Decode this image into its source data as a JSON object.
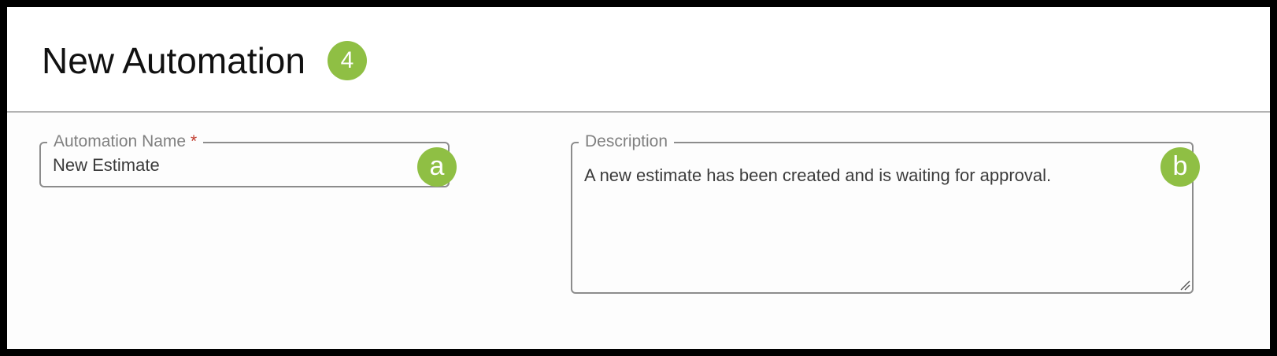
{
  "header": {
    "title": "New Automation",
    "badge": "4"
  },
  "form": {
    "name_field": {
      "label": "Automation Name",
      "required_mark": "*",
      "value": "New Estimate",
      "badge": "a"
    },
    "description_field": {
      "label": "Description",
      "value": "A new estimate has been created and is waiting for approval.",
      "badge": "b",
      "resize_handle_icon": "resize-grip-icon"
    }
  },
  "colors": {
    "badge": "#8fbf44",
    "divider": "#b3b3b3",
    "field_border": "#8c8c8c",
    "required": "#c0392b",
    "label": "#808080",
    "outer_frame": "#000000"
  }
}
